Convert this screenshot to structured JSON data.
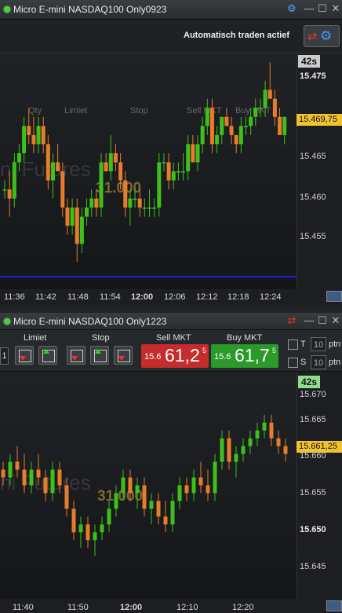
{
  "window1": {
    "title": "Micro E-mini NASDAQ100 Only0923",
    "auto_trade_label": "Automatisch traden actief",
    "timer": "42s",
    "price_tag": "15.469,75",
    "watermark": "ni Futures",
    "volume_text": "31.000",
    "hidden_headers": [
      "Qty",
      "Limiet",
      "Stop",
      "Sell MKT",
      "Buy MKT"
    ],
    "y_labels": [
      "15.475",
      "15.470",
      "15.465",
      "15.460",
      "15.455"
    ],
    "x_labels": [
      "11:36",
      "11:42",
      "11:48",
      "11:54",
      "12:00",
      "12:06",
      "12:12",
      "12:18",
      "12:24"
    ]
  },
  "window2": {
    "title": "Micro E-mini NASDAQ100 Only1223",
    "timer": "42s",
    "price_tag": "15.661,25",
    "watermark": "ni Futures",
    "volume_text": "31.000",
    "y_labels": [
      "15.670",
      "15.665",
      "15.660",
      "15.655",
      "15.650",
      "15.645"
    ],
    "x_labels": [
      "11:40",
      "11:50",
      "12:00",
      "12:10",
      "12:20"
    ]
  },
  "order_panel": {
    "qty_value": "1",
    "limiet_label": "Limiet",
    "stop_label": "Stop",
    "sell_label": "Sell MKT",
    "buy_label": "Buy MKT",
    "sell_price_small": "15.6",
    "sell_price_big": "61,2",
    "sell_price_sup": "5",
    "buy_price_small": "15.6",
    "buy_price_big": "61,7",
    "buy_price_sup": "5",
    "t_label": "T",
    "s_label": "S",
    "t_value": "10",
    "s_value": "10",
    "unit_label": "ptn"
  },
  "colors": {
    "up": "#3ec01a",
    "down": "#e87c2a",
    "price_tag": "#f1c232",
    "sell": "#cc2a2a",
    "buy": "#2a9a2a"
  },
  "chart_data": [
    {
      "type": "candlestick",
      "x": [
        "11:36",
        "11:42",
        "11:48",
        "11:54",
        "12:00",
        "12:06",
        "12:12",
        "12:18",
        "12:24"
      ],
      "ylim": [
        15.451,
        15.477
      ],
      "candles": [
        [
          15.462,
          15.463,
          15.461,
          15.462
        ],
        [
          15.462,
          15.464,
          15.459,
          15.461
        ],
        [
          15.461,
          15.466,
          15.46,
          15.465
        ],
        [
          15.465,
          15.467,
          15.464,
          15.466
        ],
        [
          15.466,
          15.47,
          15.465,
          15.469
        ],
        [
          15.469,
          15.471,
          15.467,
          15.468
        ],
        [
          15.468,
          15.47,
          15.466,
          15.467
        ],
        [
          15.467,
          15.47,
          15.466,
          15.469
        ],
        [
          15.469,
          15.47,
          15.466,
          15.467
        ],
        [
          15.467,
          15.468,
          15.462,
          15.463
        ],
        [
          15.463,
          15.466,
          15.461,
          15.465
        ],
        [
          15.465,
          15.467,
          15.464,
          15.464
        ],
        [
          15.464,
          15.465,
          15.459,
          15.46
        ],
        [
          15.46,
          15.461,
          15.457,
          15.458
        ],
        [
          15.458,
          15.461,
          15.457,
          15.46
        ],
        [
          15.46,
          15.461,
          15.454,
          15.456
        ],
        [
          15.456,
          15.46,
          15.455,
          15.459
        ],
        [
          15.459,
          15.461,
          15.458,
          15.46
        ],
        [
          15.46,
          15.462,
          15.459,
          15.461
        ],
        [
          15.461,
          15.462,
          15.459,
          15.46
        ],
        [
          15.46,
          15.466,
          15.459,
          15.465
        ],
        [
          15.465,
          15.466,
          15.464,
          15.464
        ],
        [
          15.464,
          15.468,
          15.463,
          15.466
        ],
        [
          15.466,
          15.467,
          15.464,
          15.465
        ],
        [
          15.465,
          15.466,
          15.462,
          15.463
        ],
        [
          15.463,
          15.464,
          15.459,
          15.46
        ],
        [
          15.46,
          15.462,
          15.458,
          15.461
        ],
        [
          15.461,
          15.462,
          15.46,
          15.461
        ],
        [
          15.461,
          15.462,
          15.459,
          15.46
        ],
        [
          15.46,
          15.461,
          15.459,
          15.46
        ],
        [
          15.46,
          15.462,
          15.459,
          15.46
        ],
        [
          15.46,
          15.461,
          15.459,
          15.46
        ],
        [
          15.46,
          15.466,
          15.459,
          15.465
        ],
        [
          15.465,
          15.466,
          15.464,
          15.465
        ],
        [
          15.465,
          15.466,
          15.462,
          15.463
        ],
        [
          15.463,
          15.465,
          15.462,
          15.464
        ],
        [
          15.464,
          15.465,
          15.463,
          15.464
        ],
        [
          15.464,
          15.466,
          15.463,
          15.464
        ],
        [
          15.464,
          15.468,
          15.463,
          15.467
        ],
        [
          15.467,
          15.468,
          15.465,
          15.465
        ],
        [
          15.465,
          15.468,
          15.464,
          15.467
        ],
        [
          15.467,
          15.47,
          15.466,
          15.469
        ],
        [
          15.469,
          15.472,
          15.468,
          15.471
        ],
        [
          15.471,
          15.472,
          15.466,
          15.467
        ],
        [
          15.467,
          15.469,
          15.466,
          15.468
        ],
        [
          15.468,
          15.47,
          15.467,
          15.47
        ],
        [
          15.47,
          15.471,
          15.469,
          15.469
        ],
        [
          15.469,
          15.47,
          15.467,
          15.468
        ],
        [
          15.468,
          15.468,
          15.466,
          15.467
        ],
        [
          15.467,
          15.47,
          15.466,
          15.469
        ],
        [
          15.469,
          15.47,
          15.468,
          15.469
        ],
        [
          15.469,
          15.471,
          15.468,
          15.47
        ],
        [
          15.47,
          15.472,
          15.469,
          15.471
        ],
        [
          15.471,
          15.472,
          15.47,
          15.471
        ],
        [
          15.471,
          15.474,
          15.47,
          15.473
        ],
        [
          15.473,
          15.476,
          15.472,
          15.472
        ],
        [
          15.472,
          15.473,
          15.469,
          15.47
        ],
        [
          15.47,
          15.471,
          15.468,
          15.468
        ],
        [
          15.468,
          15.47,
          15.467,
          15.47
        ]
      ]
    },
    {
      "type": "candlestick",
      "x": [
        "11:40",
        "11:50",
        "12:00",
        "12:10",
        "12:20"
      ],
      "ylim": [
        15.6425,
        15.6715
      ],
      "candles": [
        [
          15.659,
          15.66,
          15.657,
          15.658
        ],
        [
          15.658,
          15.661,
          15.657,
          15.66
        ],
        [
          15.66,
          15.662,
          15.658,
          15.659
        ],
        [
          15.659,
          15.661,
          15.656,
          15.657
        ],
        [
          15.657,
          15.66,
          15.656,
          15.659
        ],
        [
          15.659,
          15.661,
          15.657,
          15.658
        ],
        [
          15.658,
          15.659,
          15.655,
          15.656
        ],
        [
          15.656,
          15.66,
          15.655,
          15.659
        ],
        [
          15.659,
          15.66,
          15.656,
          15.657
        ],
        [
          15.657,
          15.658,
          15.653,
          15.654
        ],
        [
          15.654,
          15.655,
          15.65,
          15.651
        ],
        [
          15.651,
          15.653,
          15.649,
          15.652
        ],
        [
          15.652,
          15.653,
          15.649,
          15.65
        ],
        [
          15.65,
          15.652,
          15.648,
          15.651
        ],
        [
          15.651,
          15.653,
          15.65,
          15.652
        ],
        [
          15.652,
          15.655,
          15.651,
          15.654
        ],
        [
          15.654,
          15.657,
          15.653,
          15.656
        ],
        [
          15.656,
          15.659,
          15.655,
          15.658
        ],
        [
          15.658,
          15.659,
          15.655,
          15.656
        ],
        [
          15.656,
          15.658,
          15.654,
          15.657
        ],
        [
          15.657,
          15.658,
          15.653,
          15.654
        ],
        [
          15.654,
          15.656,
          15.652,
          15.655
        ],
        [
          15.655,
          15.656,
          15.652,
          15.653
        ],
        [
          15.653,
          15.655,
          15.651,
          15.652
        ],
        [
          15.652,
          15.656,
          15.651,
          15.655
        ],
        [
          15.655,
          15.658,
          15.654,
          15.657
        ],
        [
          15.657,
          15.658,
          15.655,
          15.656
        ],
        [
          15.656,
          15.659,
          15.655,
          15.658
        ],
        [
          15.658,
          15.66,
          15.656,
          15.657
        ],
        [
          15.657,
          15.659,
          15.655,
          15.656
        ],
        [
          15.656,
          15.661,
          15.655,
          15.66
        ],
        [
          15.66,
          15.664,
          15.659,
          15.663
        ],
        [
          15.663,
          15.664,
          15.659,
          15.66
        ],
        [
          15.66,
          15.662,
          15.658,
          15.661
        ],
        [
          15.661,
          15.663,
          15.66,
          15.662
        ],
        [
          15.662,
          15.664,
          15.661,
          15.663
        ],
        [
          15.663,
          15.665,
          15.662,
          15.664
        ],
        [
          15.664,
          15.666,
          15.663,
          15.665
        ],
        [
          15.665,
          15.666,
          15.662,
          15.663
        ],
        [
          15.663,
          15.664,
          15.661,
          15.662
        ],
        [
          15.662,
          15.663,
          15.66,
          15.661
        ]
      ]
    }
  ]
}
